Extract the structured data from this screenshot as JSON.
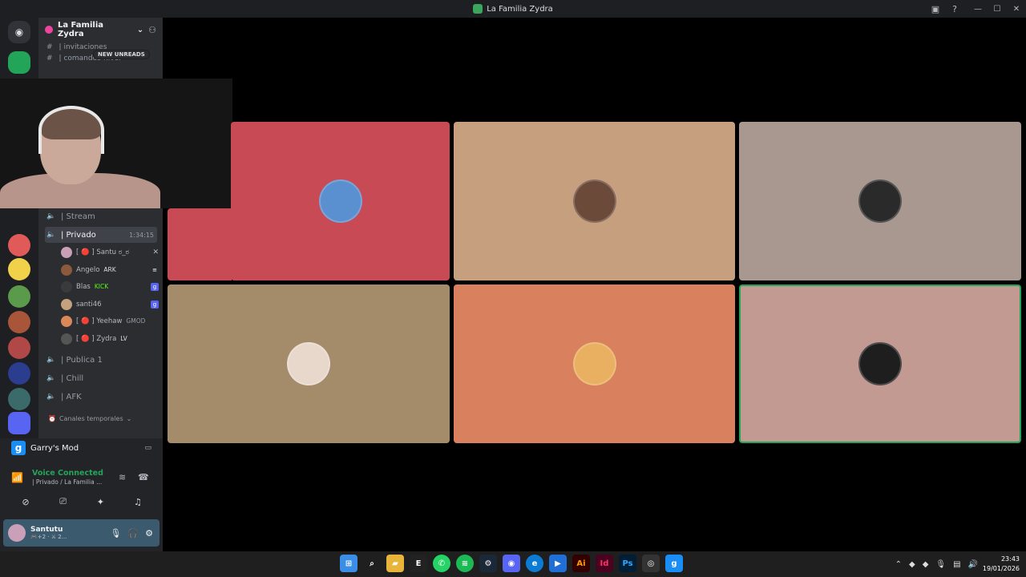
{
  "window": {
    "title": "La Familia Zydra"
  },
  "server": {
    "name": "La Familia Zydra"
  },
  "text_channels": [
    {
      "label": "| invitaciones"
    },
    {
      "label": "| comandos-nivel"
    }
  ],
  "new_unreads": "NEW UNREADS",
  "voice_channels": [
    {
      "label": "| Stream",
      "active": false
    },
    {
      "label": "| Privado",
      "active": true,
      "timer": "1:34:15"
    },
    {
      "label": "| Publica 1",
      "active": false
    },
    {
      "label": "| Chill",
      "active": false
    },
    {
      "label": "| AFK",
      "active": false
    }
  ],
  "voice_users": [
    {
      "name": "[ 🔴 ] Santu ಠ_ಠ",
      "badge": "",
      "color": "#c9a0b8"
    },
    {
      "name": "Angelo",
      "badge": "ARK",
      "color": "#8b5a3c"
    },
    {
      "name": "Blas",
      "badge": "KICK",
      "color": "#3a3a3a"
    },
    {
      "name": "santi46",
      "badge": "",
      "color": "#c4a27e"
    },
    {
      "name": "[ 🔴 ] Yeehaw",
      "badge": "GMOD",
      "color": "#d9885a"
    },
    {
      "name": "[ 🔴 ] Zydra",
      "badge": "LV",
      "color": "#555"
    }
  ],
  "category": {
    "label": "Canales temporales"
  },
  "activity": {
    "game": "Garry's Mod"
  },
  "voice_status": {
    "status": "Voice Connected",
    "location": "| Privado / La Familia ..."
  },
  "user": {
    "name": "Santutu",
    "sub": "🎮+2 · ⚔ 2..."
  },
  "tiles": [
    {
      "color": "#c84a55",
      "avatar": "#5a8fd0",
      "speaking": false
    },
    {
      "color": "#c6a07e",
      "avatar": "#6b4a3a",
      "speaking": false
    },
    {
      "color": "#a89890",
      "avatar": "#2a2a2a",
      "speaking": false
    },
    {
      "color": "#a48b6a",
      "avatar": "#e8d8cc",
      "speaking": false
    },
    {
      "color": "#d9805e",
      "avatar": "#e8b060",
      "speaking": false
    },
    {
      "color": "#c39a92",
      "avatar": "#1e1e1e",
      "speaking": true
    }
  ],
  "clock": {
    "time": "23:43",
    "date": "19/01/2026"
  }
}
